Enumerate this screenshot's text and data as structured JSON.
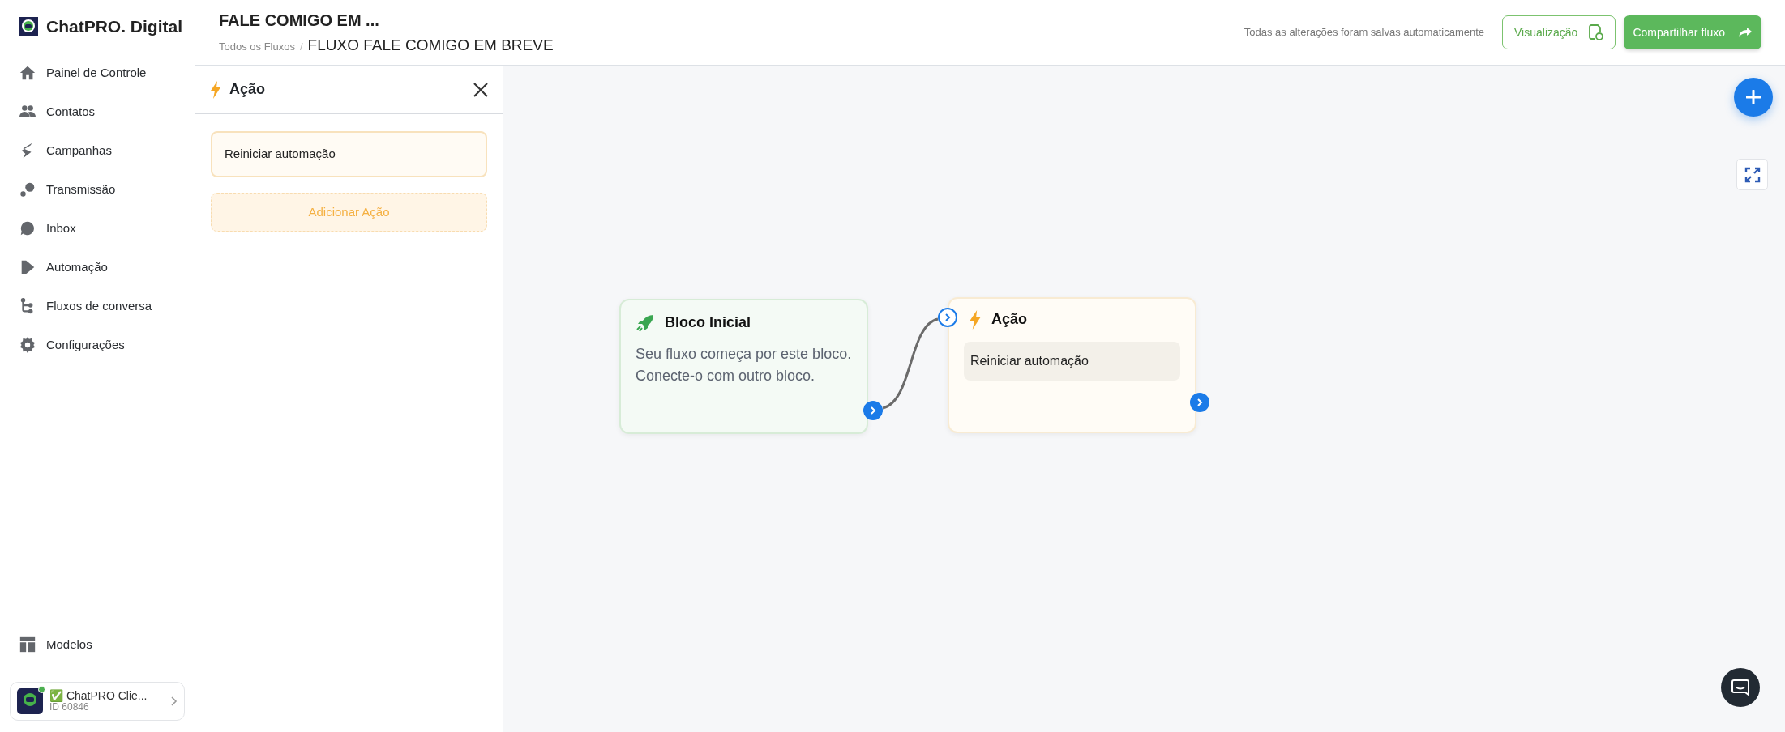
{
  "brand": {
    "name": "ChatPRO. Digital"
  },
  "sidebar": {
    "items": [
      {
        "label": "Painel de Controle"
      },
      {
        "label": "Contatos"
      },
      {
        "label": "Campanhas"
      },
      {
        "label": "Transmissão"
      },
      {
        "label": "Inbox"
      },
      {
        "label": "Automação"
      },
      {
        "label": "Fluxos de conversa"
      },
      {
        "label": "Configurações"
      }
    ],
    "bottom_items": [
      {
        "label": "Modelos"
      }
    ],
    "account": {
      "name": "✅ ChatPRO Clie...",
      "id": "ID 60846",
      "online": true
    }
  },
  "header": {
    "title": "FALE COMIGO EM ...",
    "breadcrumb": [
      "Todos os Fluxos",
      "FLUXO FALE COMIGO EM BREVE"
    ],
    "breadcrumb_separator": "/",
    "save_status": "Todas as alterações foram salvas automaticamente",
    "buttons": [
      {
        "kind": "outline",
        "label": "Visualização"
      },
      {
        "kind": "primary",
        "label": "Compartilhar fluxo"
      }
    ]
  },
  "panel": {
    "title": "Ação",
    "actions": [
      "Reiniciar automação"
    ],
    "add_button": "Adicionar Ação"
  },
  "canvas": {
    "nodes": [
      {
        "kind": "start",
        "title": "Bloco Inicial",
        "text": "Seu fluxo começa por este bloco. Conecte-o com outro bloco."
      },
      {
        "kind": "action",
        "title": "Ação",
        "items": [
          "Reiniciar automação"
        ]
      }
    ]
  }
}
